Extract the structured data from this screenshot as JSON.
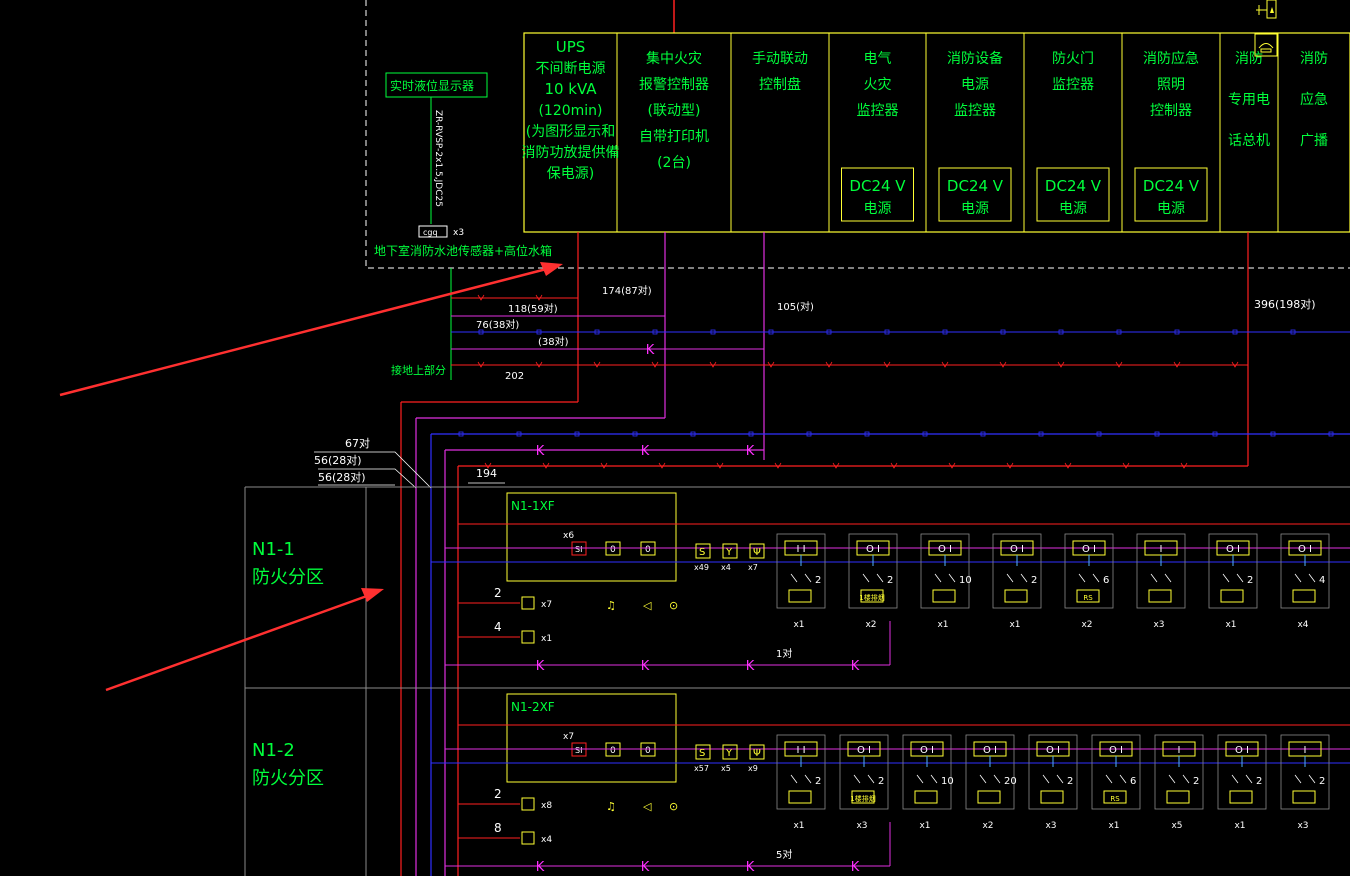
{
  "colors": {
    "background": "#000000",
    "frame": "#ffff33",
    "label_green": "#00ff3c",
    "line_red": "#ff2020",
    "line_blue": "#3030ff",
    "line_magenta": "#e030e0",
    "line_white": "#ffffff",
    "arrow_red": "#ff3030",
    "zone_border": "#8a8a8a",
    "device_cyan": "#4fb0ff"
  },
  "header_cells": [
    {
      "lines": [
        "UPS",
        "不间断电源",
        "10 kVA",
        "(120min)",
        "(为图形显示和",
        "消防功放提供備",
        "保电源)"
      ],
      "dc": null
    },
    {
      "lines": [
        "集中火灾",
        "报警控制器",
        "(联动型)",
        "自带打印机",
        "(2台)"
      ],
      "dc": null
    },
    {
      "lines": [
        "手动联动",
        "控制盘"
      ],
      "dc": null
    },
    {
      "lines": [
        "电气",
        "火灾",
        "监控器"
      ],
      "dc": [
        "DC24 V",
        "电源"
      ]
    },
    {
      "lines": [
        "消防设备",
        "电源",
        "监控器"
      ],
      "dc": [
        "DC24 V",
        "电源"
      ]
    },
    {
      "lines": [
        "防火门",
        "监控器"
      ],
      "dc": [
        "DC24 V",
        "电源"
      ]
    },
    {
      "lines": [
        "消防应急",
        "照明",
        "控制器"
      ],
      "dc": [
        "DC24 V",
        "电源"
      ]
    },
    {
      "lines": [
        "消防",
        "专用电",
        "话总机"
      ],
      "dc": null
    },
    {
      "lines": [
        "消防",
        "应急",
        "广播"
      ],
      "dc": null
    }
  ],
  "liquid_display": "实时液位显示器",
  "liquid_cable": "ZR-RVSP-2x1.5,JDC25",
  "sensor_box": "cgq",
  "sensor_mult": "x3",
  "sensor_caption": "地下室消防水池传感器+高位水箱",
  "ground_part": "接地上部分",
  "bus_labels": {
    "a": "174(87对)",
    "b": "118(59对)",
    "c": "76(38对)",
    "d": "(38对)",
    "e": "202",
    "f": "105(对)",
    "g": "396(198对)",
    "h": "67对",
    "i": "56(28对)",
    "j": "56(28对)",
    "k": "194"
  },
  "zones": [
    {
      "zone_line1": "N1-1",
      "zone_line2": "防火分区",
      "panel": "N1-1XF",
      "si_mult": "x6",
      "pair_label": "1对",
      "left_counts": [
        "2",
        "4"
      ],
      "left_mults": [
        "x7",
        "x1"
      ],
      "row_mults": [
        "x49",
        "x4",
        "x7"
      ],
      "devices": [
        {
          "code": "I  I",
          "count": "2",
          "label": "",
          "mult": "x1"
        },
        {
          "code": "O I",
          "count": "2",
          "label": "1楼排烟",
          "mult": "x2"
        },
        {
          "code": "O I",
          "count": "10",
          "label": "",
          "mult": "x1"
        },
        {
          "code": "O I",
          "count": "2",
          "label": "",
          "mult": "x1"
        },
        {
          "code": "O I",
          "count": "6",
          "label": "RS",
          "mult": "x2"
        },
        {
          "code": "I",
          "count": "",
          "label": "",
          "mult": "x3"
        },
        {
          "code": "O I",
          "count": "2",
          "label": "",
          "mult": "x1"
        },
        {
          "code": "O I",
          "count": "4",
          "label": "",
          "mult": "x4"
        }
      ]
    },
    {
      "zone_line1": "N1-2",
      "zone_line2": "防火分区",
      "panel": "N1-2XF",
      "si_mult": "x7",
      "pair_label": "5对",
      "left_counts": [
        "2",
        "8"
      ],
      "left_mults": [
        "x8",
        "x4"
      ],
      "row_mults": [
        "x57",
        "x5",
        "x9"
      ],
      "devices": [
        {
          "code": "I  I",
          "count": "2",
          "label": "",
          "mult": "x1"
        },
        {
          "code": "O I",
          "count": "2",
          "label": "1楼排烟",
          "mult": "x3"
        },
        {
          "code": "O I",
          "count": "10",
          "label": "",
          "mult": "x1"
        },
        {
          "code": "O I",
          "count": "20",
          "label": "",
          "mult": "x2"
        },
        {
          "code": "O I",
          "count": "2",
          "label": "",
          "mult": "x3"
        },
        {
          "code": "O I",
          "count": "6",
          "label": "RS",
          "mult": "x1"
        },
        {
          "code": "I",
          "count": "2",
          "label": "",
          "mult": "x5"
        },
        {
          "code": "O I",
          "count": "2",
          "label": "",
          "mult": "x1"
        },
        {
          "code": "I",
          "count": "2",
          "label": "",
          "mult": "x3"
        }
      ]
    }
  ]
}
